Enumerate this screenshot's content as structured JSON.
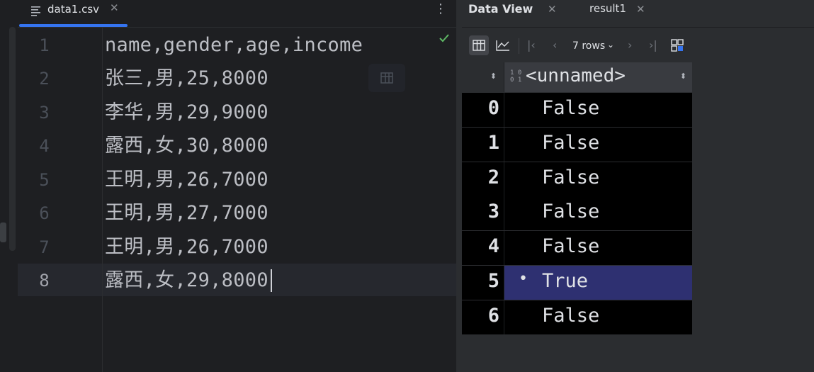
{
  "editor": {
    "tab": {
      "filename": "data1.csv"
    },
    "lines": [
      {
        "num": "1",
        "text": "name,gender,age,income"
      },
      {
        "num": "2",
        "text": "张三,男,25,8000"
      },
      {
        "num": "3",
        "text": "李华,男,29,9000"
      },
      {
        "num": "4",
        "text": "露西,女,30,8000"
      },
      {
        "num": "5",
        "text": "王明,男,26,7000"
      },
      {
        "num": "6",
        "text": "王明,男,27,7000"
      },
      {
        "num": "7",
        "text": "王明,男,26,7000"
      },
      {
        "num": "8",
        "text": "露西,女,29,8000"
      }
    ],
    "current_line": "8"
  },
  "panel": {
    "data_view_title": "Data View",
    "result_tab": "result1",
    "toolbar": {
      "rows_label": "7 rows"
    },
    "column": {
      "type_icon_text": "10\n01",
      "name": "<unnamed>"
    },
    "rows": [
      {
        "index": "0",
        "value": "False",
        "selected": false
      },
      {
        "index": "1",
        "value": "False",
        "selected": false
      },
      {
        "index": "2",
        "value": "False",
        "selected": false
      },
      {
        "index": "3",
        "value": "False",
        "selected": false
      },
      {
        "index": "4",
        "value": "False",
        "selected": false
      },
      {
        "index": "5",
        "value": "True",
        "selected": true,
        "marker": "•"
      },
      {
        "index": "6",
        "value": "False",
        "selected": false
      }
    ]
  },
  "colors": {
    "accent": "#3574f0",
    "selected_row": "#2e3071",
    "success_check": "#5fb865"
  }
}
